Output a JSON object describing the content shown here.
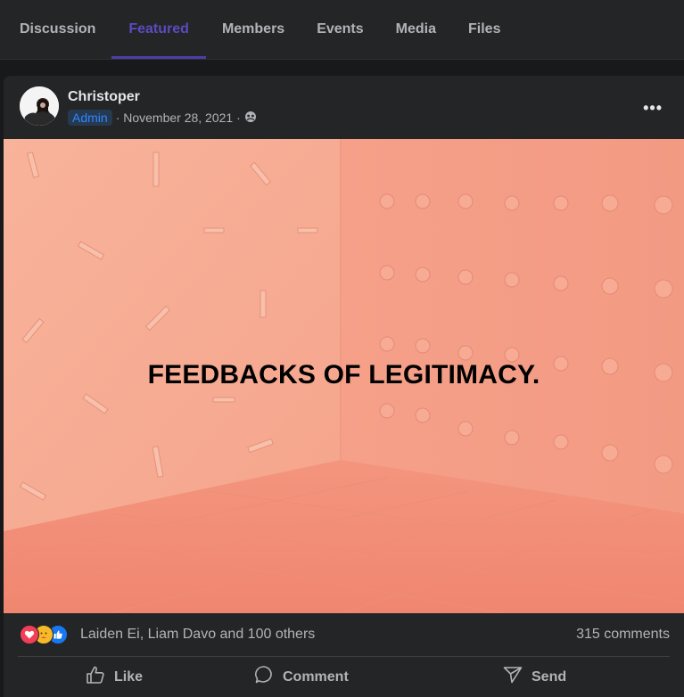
{
  "tabs": [
    {
      "label": "Discussion"
    },
    {
      "label": "Featured"
    },
    {
      "label": "Members"
    },
    {
      "label": "Events"
    },
    {
      "label": "Media"
    },
    {
      "label": "Files"
    }
  ],
  "active_tab": "Featured",
  "post": {
    "author": "Christoper",
    "role_badge": "Admin",
    "date": "· November 28, 2021 ·",
    "privacy_icon": "group-icon",
    "more_icon": "more-options-icon",
    "image_headline": "FEEDBACKS OF LEGITIMACY.",
    "reactions": {
      "icons": [
        "love-reaction-icon",
        "care-reaction-icon",
        "like-reaction-icon"
      ],
      "reactors_text": "Laiden Ei, Liam Davo and 100 others"
    },
    "comments_count": "315 comments",
    "actions": {
      "like": "Like",
      "comment": "Comment",
      "send": "Send"
    }
  },
  "colors": {
    "background": "#18191a",
    "surface": "#242526",
    "accent_tab": "#5b4bbf",
    "badge_text": "#2d88ff",
    "image_bg": "#f39c86"
  }
}
